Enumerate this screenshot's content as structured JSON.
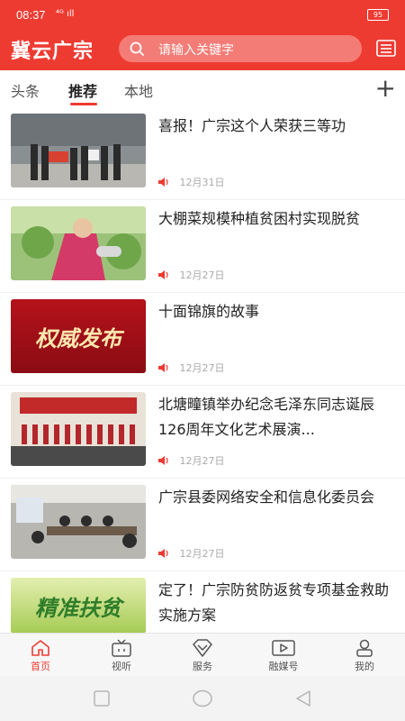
{
  "status": {
    "time": "08:37",
    "signal": "⁴ᴳ ıll",
    "battery": "95"
  },
  "header": {
    "logo": "冀云广宗",
    "search_placeholder": "请输入关键字"
  },
  "tabs": [
    {
      "label": "头条"
    },
    {
      "label": "推荐"
    },
    {
      "label": "本地"
    }
  ],
  "thumb_texts": {
    "item3": "权威发布",
    "item6": "精准扶贫"
  },
  "articles": [
    {
      "title": "喜报！广宗这个人荣获三等功",
      "date": "12月31日"
    },
    {
      "title": "大棚菜规模种植贫困村实现脱贫",
      "date": "12月27日"
    },
    {
      "title": "十面锦旗的故事",
      "date": "12月27日"
    },
    {
      "title": "北塘疃镇举办纪念毛泽东同志诞辰126周年文化艺术展演...",
      "date": "12月27日"
    },
    {
      "title": "广宗县委网络安全和信息化委员会",
      "date": "12月27日"
    },
    {
      "title": "定了！广宗防贫防返贫专项基金救助实施方案",
      "date": ""
    }
  ],
  "bottom_nav": [
    {
      "label": "首页"
    },
    {
      "label": "视听"
    },
    {
      "label": "服务"
    },
    {
      "label": "融媒号"
    },
    {
      "label": "我的"
    }
  ],
  "colors": {
    "brand": "#ee3b32",
    "muted": "#aaaaaa"
  }
}
